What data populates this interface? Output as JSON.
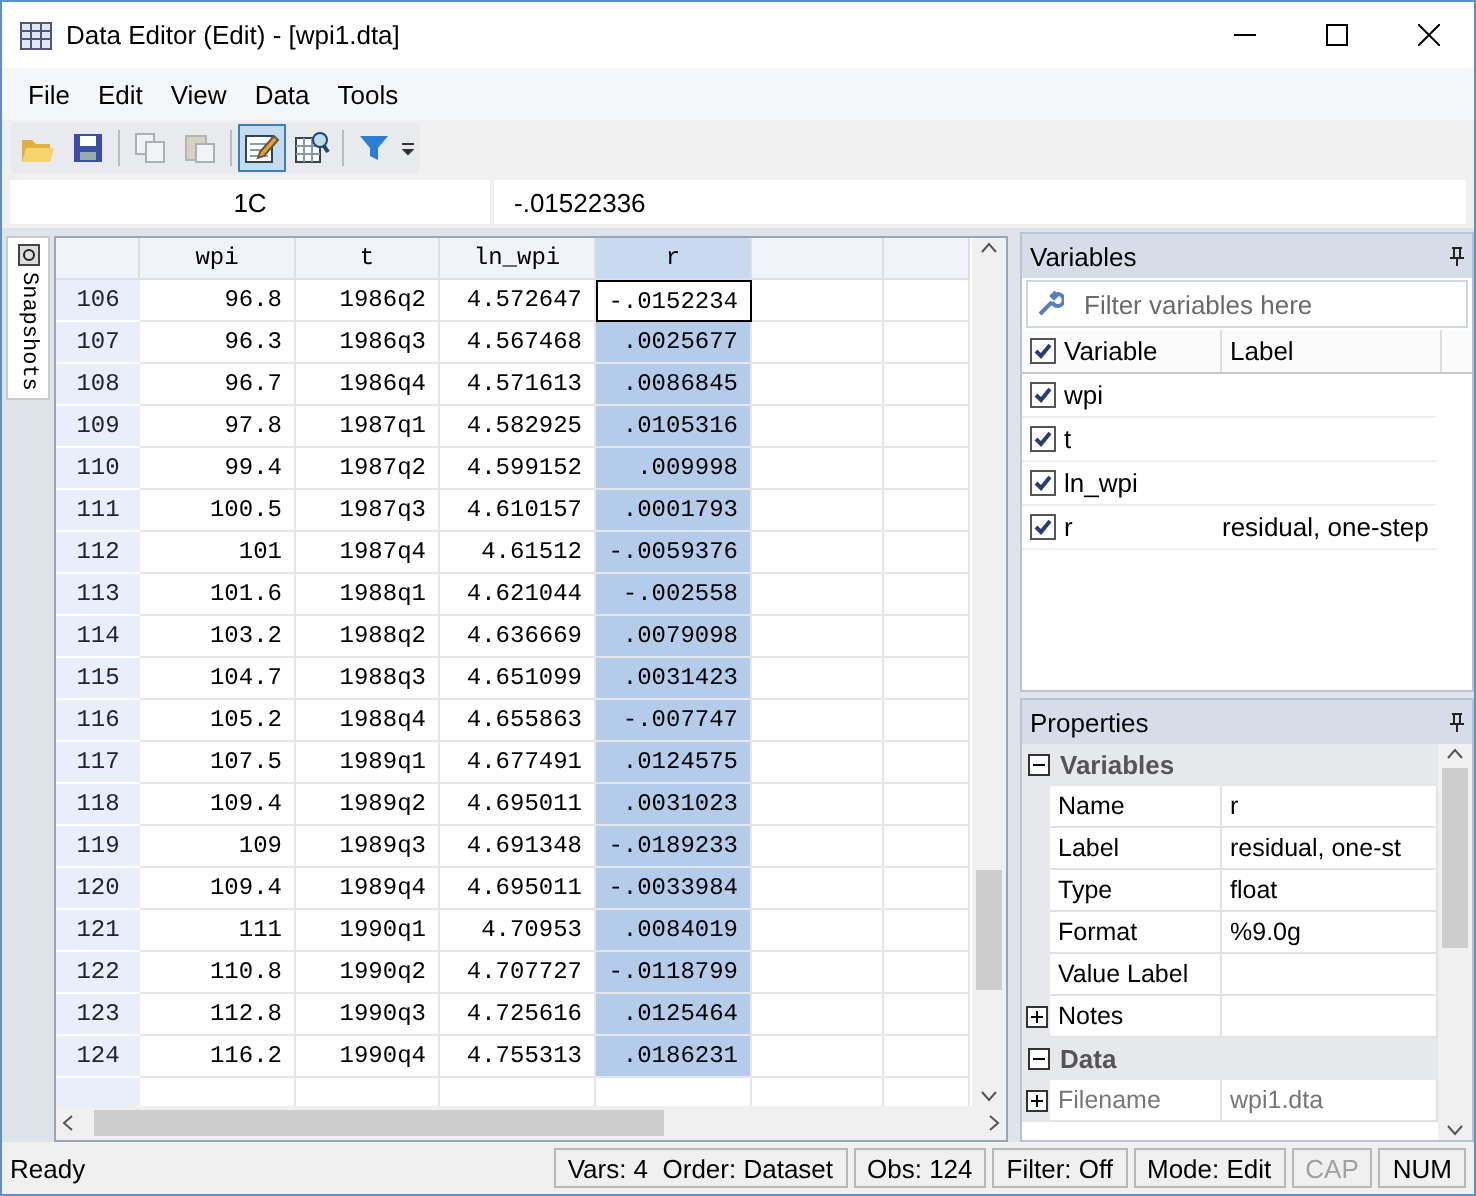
{
  "window": {
    "title": "Data Editor (Edit) - [wpi1.dta]"
  },
  "menu": [
    "File",
    "Edit",
    "View",
    "Data",
    "Tools"
  ],
  "toolbar": [
    {
      "kind": "open",
      "disabled": false,
      "selected": false
    },
    {
      "kind": "save",
      "disabled": false,
      "selected": false
    },
    {
      "kind": "copy",
      "disabled": true,
      "selected": false
    },
    {
      "kind": "paste",
      "disabled": true,
      "selected": false
    },
    {
      "kind": "edit",
      "disabled": false,
      "selected": true
    },
    {
      "kind": "browse",
      "disabled": false,
      "selected": false
    },
    {
      "kind": "filter",
      "disabled": false,
      "selected": false
    }
  ],
  "cell_bar": {
    "cell": "1C",
    "value": "-.01522336"
  },
  "snapshots_tab": "Snapshots",
  "grid": {
    "columns": [
      {
        "name": "wpi",
        "selected": false
      },
      {
        "name": "t",
        "selected": false
      },
      {
        "name": "ln_wpi",
        "selected": false
      },
      {
        "name": "r",
        "selected": true
      }
    ],
    "rows": [
      {
        "number": "106",
        "cells": [
          "96.8",
          "1986q2",
          "4.572647",
          "-.0152234"
        ],
        "r_selected": true,
        "current": true
      },
      {
        "number": "107",
        "cells": [
          "96.3",
          "1986q3",
          "4.567468",
          ".0025677"
        ],
        "r_selected": true,
        "current": false
      },
      {
        "number": "108",
        "cells": [
          "96.7",
          "1986q4",
          "4.571613",
          ".0086845"
        ],
        "r_selected": true,
        "current": false
      },
      {
        "number": "109",
        "cells": [
          "97.8",
          "1987q1",
          "4.582925",
          ".0105316"
        ],
        "r_selected": true,
        "current": false
      },
      {
        "number": "110",
        "cells": [
          "99.4",
          "1987q2",
          "4.599152",
          ".009998"
        ],
        "r_selected": true,
        "current": false
      },
      {
        "number": "111",
        "cells": [
          "100.5",
          "1987q3",
          "4.610157",
          ".0001793"
        ],
        "r_selected": true,
        "current": false
      },
      {
        "number": "112",
        "cells": [
          "101",
          "1987q4",
          "4.61512",
          "-.0059376"
        ],
        "r_selected": true,
        "current": false
      },
      {
        "number": "113",
        "cells": [
          "101.6",
          "1988q1",
          "4.621044",
          "-.002558"
        ],
        "r_selected": true,
        "current": false
      },
      {
        "number": "114",
        "cells": [
          "103.2",
          "1988q2",
          "4.636669",
          ".0079098"
        ],
        "r_selected": true,
        "current": false
      },
      {
        "number": "115",
        "cells": [
          "104.7",
          "1988q3",
          "4.651099",
          ".0031423"
        ],
        "r_selected": true,
        "current": false
      },
      {
        "number": "116",
        "cells": [
          "105.2",
          "1988q4",
          "4.655863",
          "-.007747"
        ],
        "r_selected": true,
        "current": false
      },
      {
        "number": "117",
        "cells": [
          "107.5",
          "1989q1",
          "4.677491",
          ".0124575"
        ],
        "r_selected": true,
        "current": false
      },
      {
        "number": "118",
        "cells": [
          "109.4",
          "1989q2",
          "4.695011",
          ".0031023"
        ],
        "r_selected": true,
        "current": false
      },
      {
        "number": "119",
        "cells": [
          "109",
          "1989q3",
          "4.691348",
          "-.0189233"
        ],
        "r_selected": true,
        "current": false
      },
      {
        "number": "120",
        "cells": [
          "109.4",
          "1989q4",
          "4.695011",
          "-.0033984"
        ],
        "r_selected": true,
        "current": false
      },
      {
        "number": "121",
        "cells": [
          "111",
          "1990q1",
          "4.70953",
          ".0084019"
        ],
        "r_selected": true,
        "current": false
      },
      {
        "number": "122",
        "cells": [
          "110.8",
          "1990q2",
          "4.707727",
          "-.0118799"
        ],
        "r_selected": true,
        "current": false
      },
      {
        "number": "123",
        "cells": [
          "112.8",
          "1990q3",
          "4.725616",
          ".0125464"
        ],
        "r_selected": true,
        "current": false
      },
      {
        "number": "124",
        "cells": [
          "116.2",
          "1990q4",
          "4.755313",
          ".0186231"
        ],
        "r_selected": true,
        "current": false
      }
    ]
  },
  "variables_panel": {
    "title": "Variables",
    "filter": {
      "placeholder": "Filter variables here"
    },
    "all_checked": true,
    "columns": [
      "Variable",
      "Label"
    ],
    "items": [
      {
        "name": "wpi",
        "checked": true
      },
      {
        "name": "t",
        "checked": true
      },
      {
        "name": "ln_wpi",
        "checked": true
      },
      {
        "name": "r",
        "label": "residual, one-step",
        "checked": true
      }
    ]
  },
  "properties_panel": {
    "title": "Properties",
    "sections": [
      {
        "title": "Variables",
        "expanded": true,
        "rows": [
          {
            "name": "Name",
            "value": "r",
            "expanded": null
          },
          {
            "name": "Label",
            "value": "residual, one-st",
            "expanded": null
          },
          {
            "name": "Type",
            "value": "float",
            "expanded": null
          },
          {
            "name": "Format",
            "value": "%9.0g",
            "expanded": null
          },
          {
            "name": "Value Label",
            "value": "",
            "expanded": null
          },
          {
            "name": "Notes",
            "value": "",
            "expanded": false
          }
        ]
      },
      {
        "title": "Data",
        "expanded": true,
        "rows": [
          {
            "name": "Filename",
            "value": "wpi1.dta",
            "expanded": false
          }
        ]
      }
    ]
  },
  "status_bar": {
    "text": "Ready",
    "panes": [
      {
        "text": "Vars: 4  Order: Dataset",
        "disabled": false
      },
      {
        "text": "Obs: 124",
        "disabled": false
      },
      {
        "text": "Filter: Off",
        "disabled": false
      },
      {
        "text": "Mode: Edit",
        "disabled": false
      },
      {
        "text": "CAP",
        "disabled": true
      },
      {
        "text": "NUM",
        "disabled": false
      }
    ]
  }
}
